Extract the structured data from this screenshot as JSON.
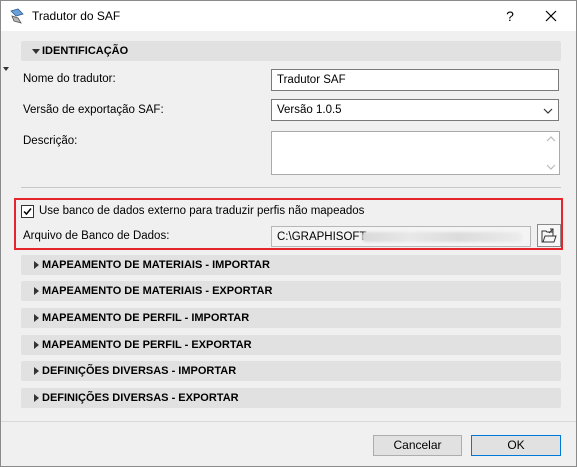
{
  "window": {
    "title": "Tradutor do SAF",
    "help_label": "?",
    "close_label": "✕"
  },
  "identification": {
    "header": "IDENTIFICAÇÃO",
    "translator_name_label": "Nome do tradutor:",
    "translator_name_value": "Tradutor SAF",
    "export_version_label": "Versão de exportação SAF:",
    "export_version_value": "Versão 1.0.5",
    "description_label": "Descrição:",
    "description_value": ""
  },
  "external_db": {
    "checkbox_label": "Use banco de dados externo para traduzir perfis não mapeados",
    "checked": true,
    "file_label": "Arquivo de Banco de Dados:",
    "file_value": "C:\\GRAPHISOFT"
  },
  "sections": [
    "MAPEAMENTO DE MATERIAIS - IMPORTAR",
    "MAPEAMENTO DE MATERIAIS - EXPORTAR",
    "MAPEAMENTO DE PERFIL - IMPORTAR",
    "MAPEAMENTO DE PERFIL - EXPORTAR",
    "DEFINIÇÕES DIVERSAS - IMPORTAR",
    "DEFINIÇÕES DIVERSAS - EXPORTAR"
  ],
  "buttons": {
    "cancel": "Cancelar",
    "ok": "OK"
  },
  "colors": {
    "highlight_border": "#e4262c",
    "section_header_bg": "#e1e1e1",
    "ok_border": "#0078d7"
  }
}
